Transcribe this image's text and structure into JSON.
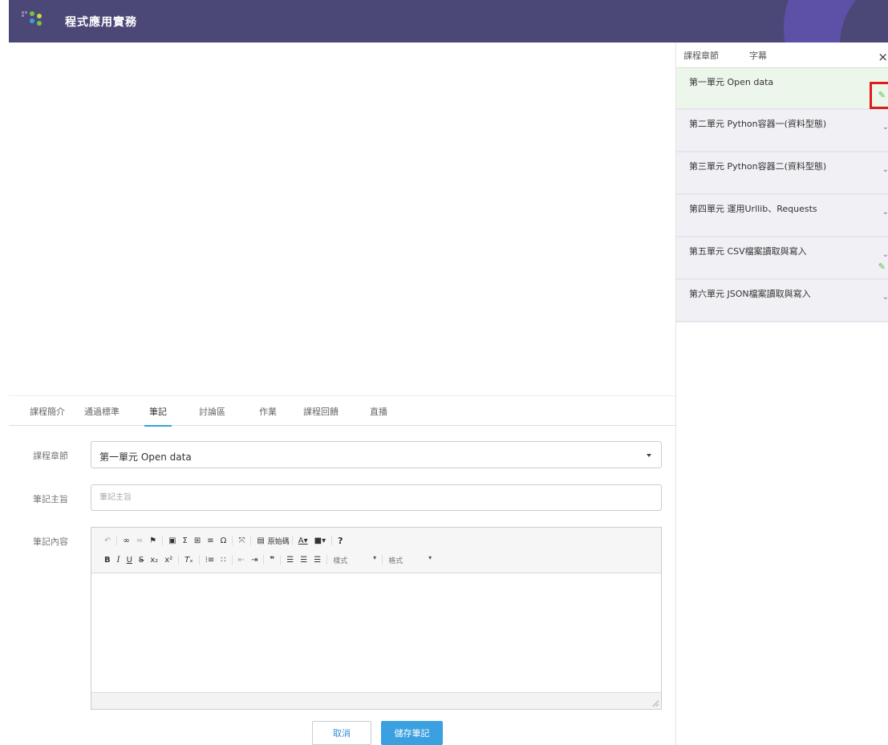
{
  "app": {
    "title": "程式應用實務",
    "accent": "#4b4878"
  },
  "tabs": [
    {
      "label": "課程簡介"
    },
    {
      "label": "通過標準"
    },
    {
      "label": "筆記",
      "active": true
    },
    {
      "label": "討論區"
    },
    {
      "label": "作業"
    },
    {
      "label": "課程回饋"
    },
    {
      "label": "直播"
    }
  ],
  "form": {
    "chapter_label": "課程章節",
    "chapter_value": "第一單元 Open data",
    "subject_label": "筆記主旨",
    "subject_placeholder": "筆記主旨",
    "content_label": "筆記內容"
  },
  "toolbar": {
    "source_label": "原始碼",
    "format_combo": "樣式",
    "style_combo": "格式",
    "help": "?"
  },
  "buttons": {
    "cancel": "取消",
    "save": "儲存筆記",
    "save_color": "#3aa0e0"
  },
  "panel": {
    "tab_chapters": "課程章節",
    "tab_subtitles": "字幕",
    "close": "×",
    "chapters": [
      {
        "title": "第一單元 Open data"
      },
      {
        "title": "第二單元 Python容器一(資料型態)"
      },
      {
        "title": "第三單元 Python容器二(資料型態)"
      },
      {
        "title": "第四單元 運用Urllib、Requests"
      },
      {
        "title": "第五單元 CSV檔案讀取與寫入"
      },
      {
        "title": "第六單元 JSON檔案讀取與寫入"
      }
    ]
  }
}
